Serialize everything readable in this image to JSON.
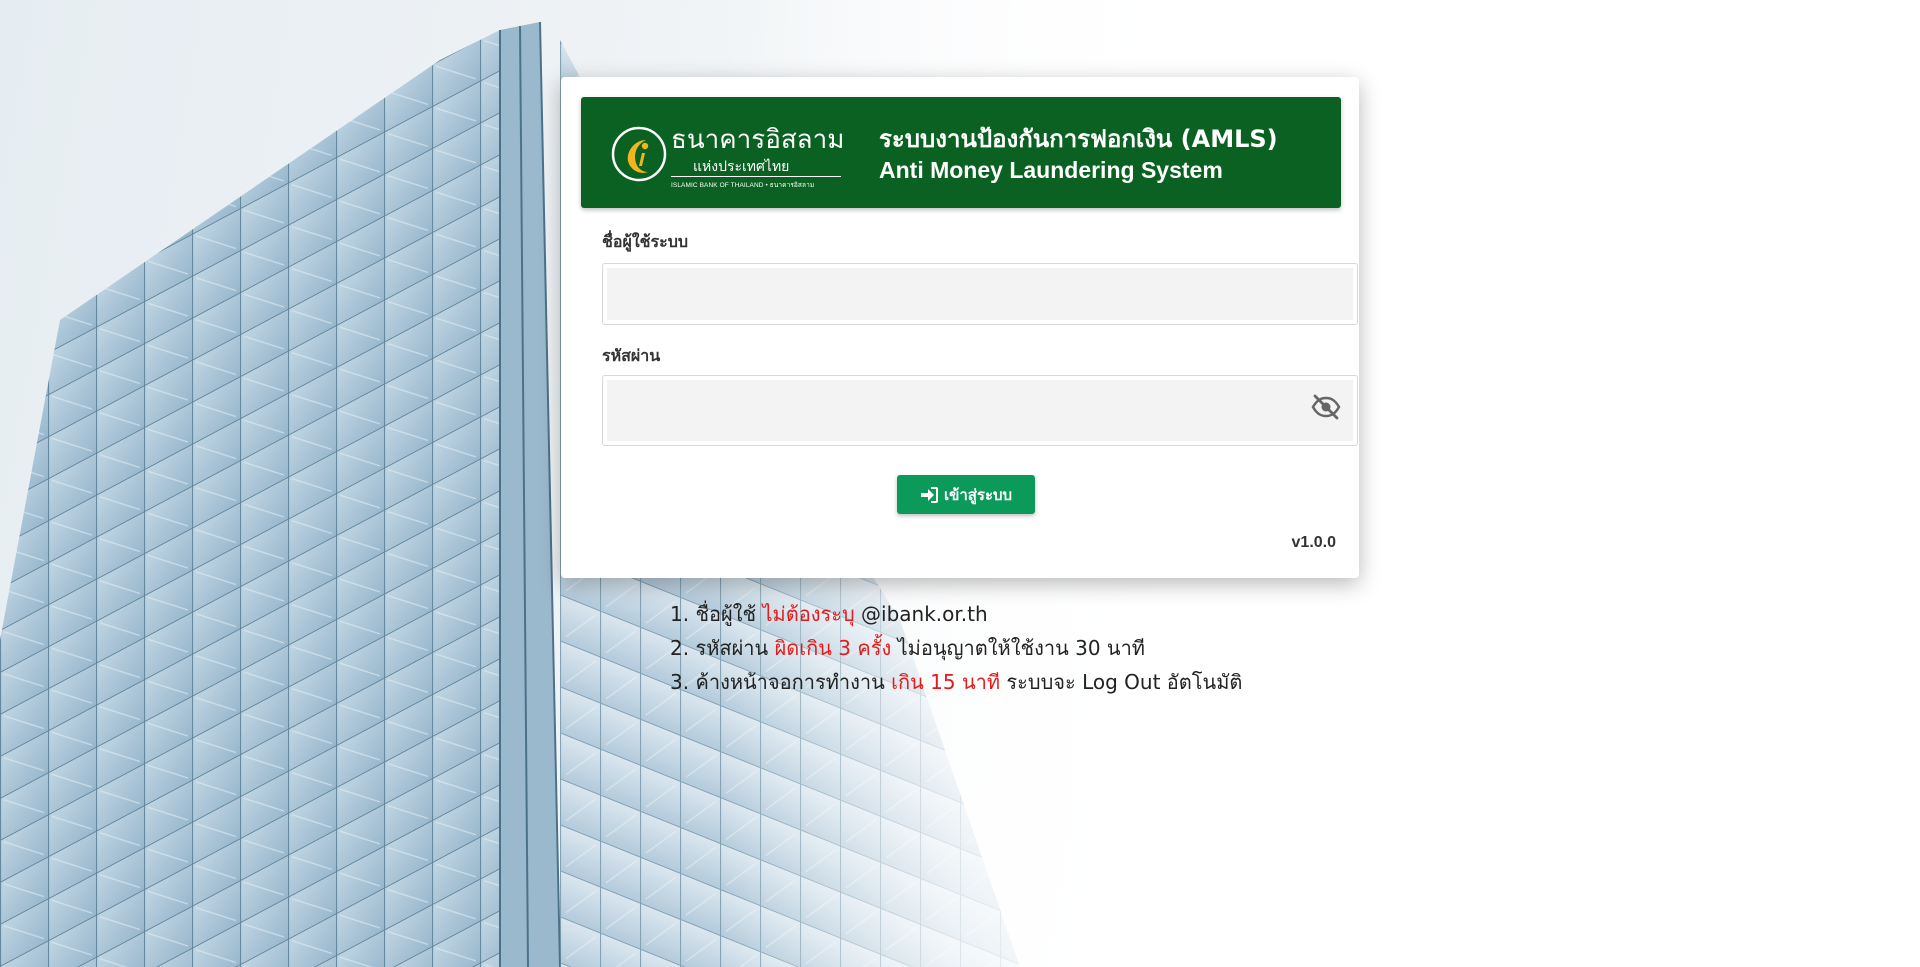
{
  "header": {
    "logo_th": "ธนาคารอิสลาม",
    "logo_th_sub": "แห่งประเทศไทย",
    "logo_en": "ISLAMIC BANK OF THAILAND • ธนาคารอิสลาม",
    "title_th": "ระบบงานป้องกันการฟอกเงิน (AMLS)",
    "title_en": "Anti Money Laundering System"
  },
  "form": {
    "username_label": "ชื่อผู้ใช้ระบบ",
    "username_value": "",
    "password_label": "รหัสผ่าน",
    "password_value": "",
    "login_label": "เข้าสู่ระบบ",
    "version": "v1.0.0"
  },
  "notes": [
    {
      "number": "1.",
      "before": "ชื่อผู้ใช้",
      "highlight": "ไม่ต้องระบุ",
      "after": "@ibank.or.th"
    },
    {
      "number": "2.",
      "before": "รหัสผ่าน",
      "highlight": "ผิดเกิน 3 ครั้ง",
      "after": "ไม่อนุญาตให้ใช้งาน 30 นาที"
    },
    {
      "number": "3.",
      "before": "ค้างหน้าจอการทำงาน",
      "highlight": "เกิน 15 นาที",
      "after": "ระบบจะ Log Out อัตโนมัติ"
    }
  ],
  "icons": {
    "logo": "crescent-star-icon",
    "password_toggle": "eye-slash-icon",
    "login": "sign-in-icon"
  },
  "colors": {
    "header_bg": "#0a6121",
    "login_button": "#0b9a5a",
    "highlight_text": "#e41b1b",
    "logo_gold": "#f2b51e"
  }
}
